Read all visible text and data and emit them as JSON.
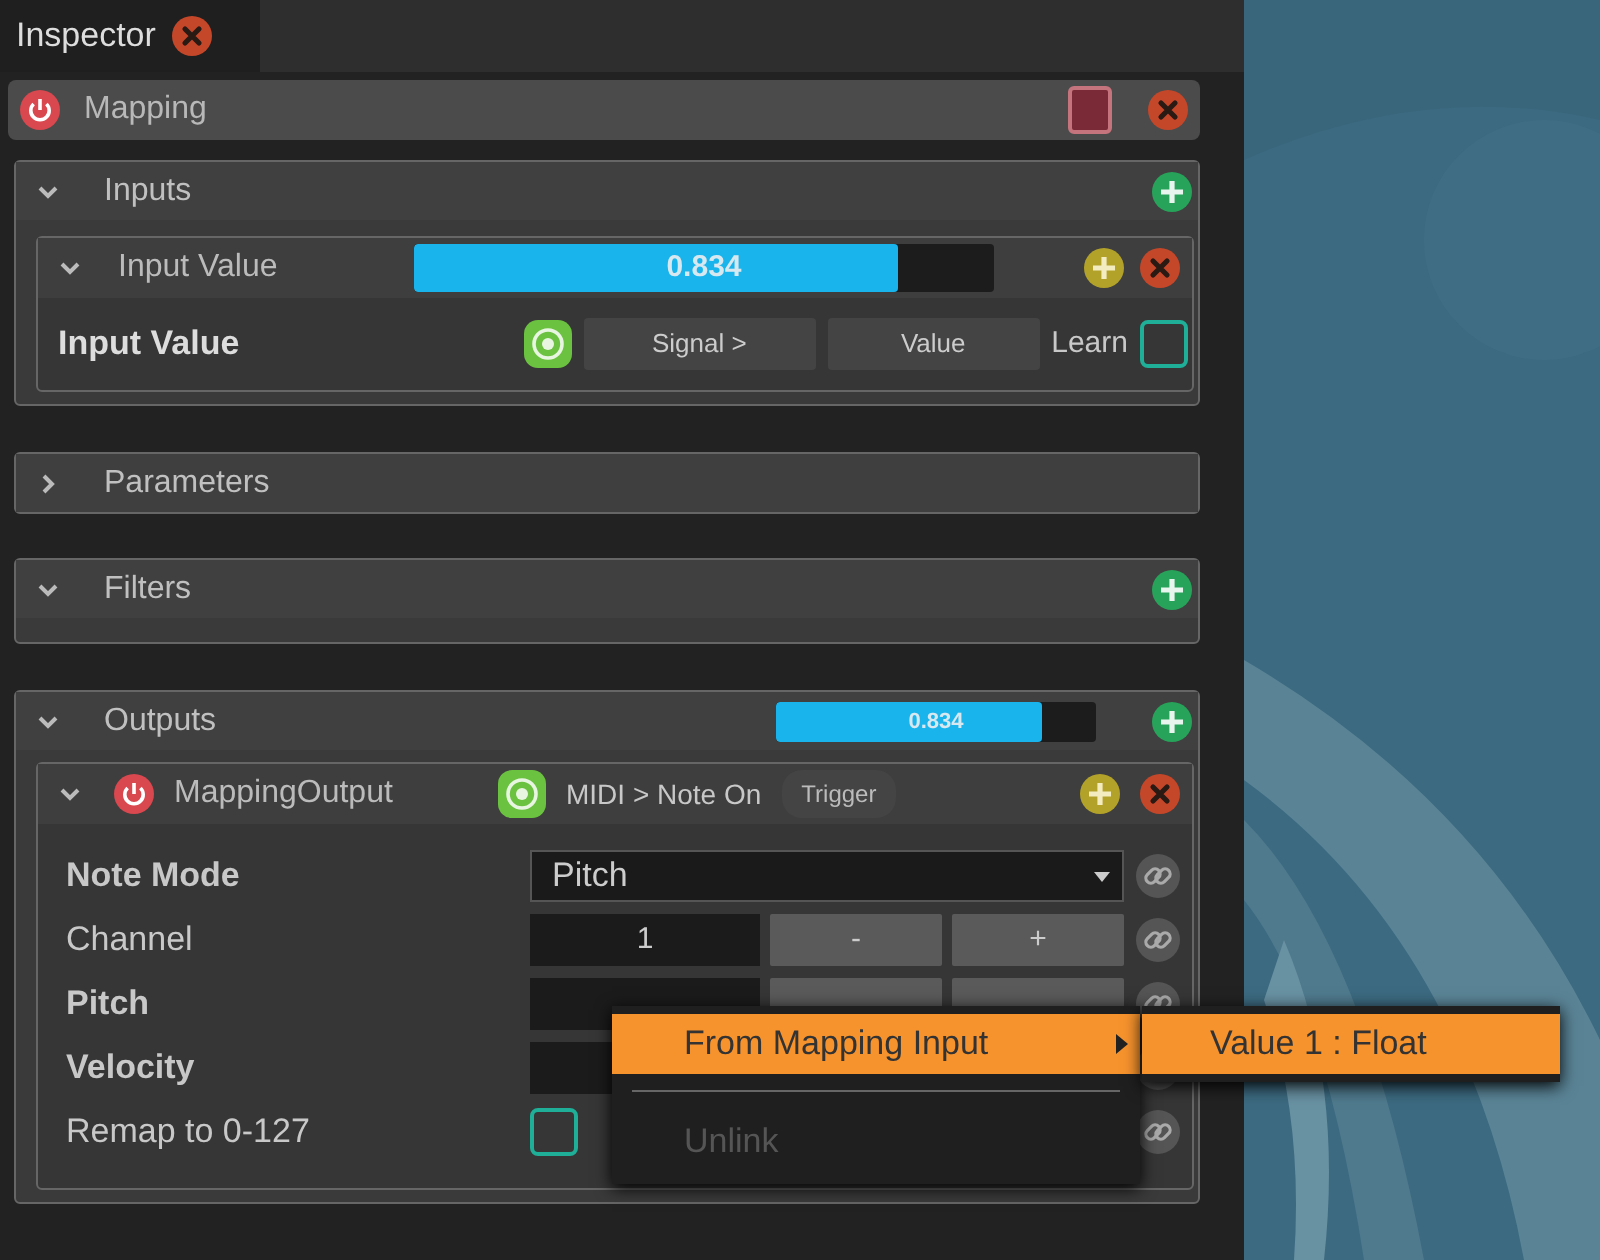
{
  "tab": {
    "title": "Inspector"
  },
  "mapping": {
    "title": "Mapping",
    "enabled": true,
    "color": "#7a2a36"
  },
  "inputs": {
    "title": "Inputs",
    "expanded": true,
    "items": [
      {
        "title": "Input Value",
        "expanded": true,
        "value_text": "0.834",
        "level": 0.834,
        "param_label": "Input Value",
        "signal_button": "Signal >",
        "value_button": "Value",
        "learn_label": "Learn",
        "learn_checked": false
      }
    ]
  },
  "parameters": {
    "title": "Parameters",
    "expanded": false
  },
  "filters": {
    "title": "Filters",
    "expanded": true
  },
  "outputs": {
    "title": "Outputs",
    "expanded": true,
    "value_text": "0.834",
    "level": 0.834,
    "items": [
      {
        "title": "MappingOutput",
        "enabled": true,
        "expanded": true,
        "target": "MIDI > Note On",
        "tag": "Trigger",
        "params": [
          {
            "kind": "select",
            "label": "Note Mode",
            "bold": true,
            "value": "Pitch"
          },
          {
            "kind": "number",
            "label": "Channel",
            "bold": false,
            "value": "1",
            "steppers": true,
            "minus": "-",
            "plus": "+"
          },
          {
            "kind": "number",
            "label": "Pitch",
            "bold": true,
            "steppers": true
          },
          {
            "kind": "number",
            "label": "Velocity",
            "bold": true
          },
          {
            "kind": "checkbox",
            "label": "Remap to 0-127",
            "bold": false,
            "checked": false
          }
        ]
      }
    ]
  },
  "context_menu": {
    "items": [
      {
        "kind": "submenu",
        "label": "From Mapping Input",
        "highlighted": true,
        "disabled": false
      },
      {
        "kind": "separator"
      },
      {
        "kind": "item",
        "label": "Unlink",
        "highlighted": false,
        "disabled": true
      }
    ],
    "submenu": [
      {
        "label": "Value 1 : Float",
        "highlighted": true
      }
    ]
  }
}
